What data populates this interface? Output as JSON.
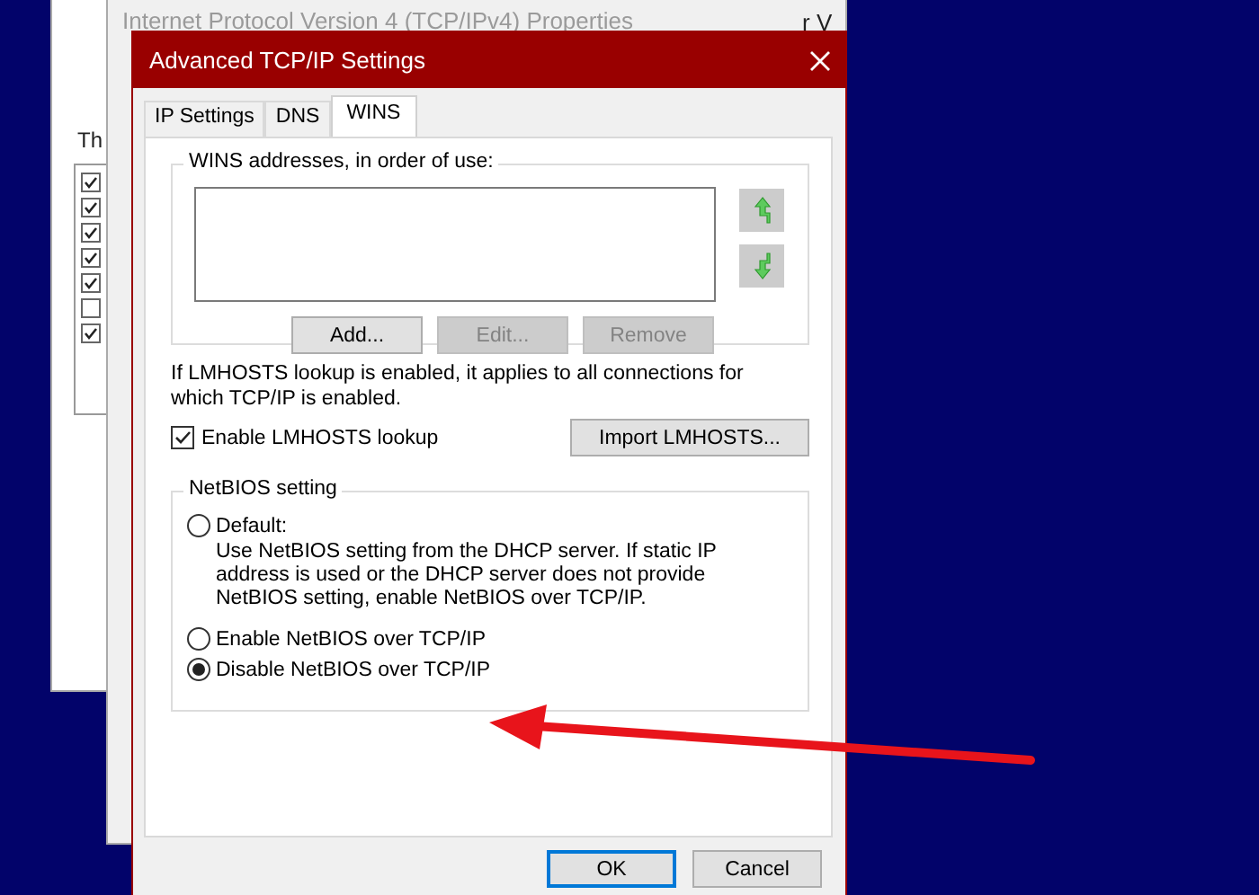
{
  "background_windows": [
    {
      "fragments": [
        "Th"
      ],
      "items": [
        {
          "checked": true
        },
        {
          "checked": true
        },
        {
          "checked": true
        },
        {
          "checked": true
        },
        {
          "checked": true
        },
        {
          "checked": false
        },
        {
          "checked": true
        }
      ]
    },
    {
      "title": "Internet Protocol Version 4 (TCP/IPv4) Properties",
      "fragments": [
        "r V"
      ]
    }
  ],
  "dialog": {
    "title": "Advanced TCP/IP Settings",
    "tabs": [
      {
        "label": "IP Settings",
        "selected": false
      },
      {
        "label": "DNS",
        "selected": false
      },
      {
        "label": "WINS",
        "selected": true
      }
    ],
    "wins_group": {
      "label": "WINS addresses, in order of use:",
      "buttons": [
        {
          "label": "Add...",
          "disabled": false
        },
        {
          "label": "Edit...",
          "disabled": true
        },
        {
          "label": "Remove",
          "disabled": true
        }
      ]
    },
    "lmhosts_note": "If LMHOSTS lookup is enabled, it applies to all connections for which TCP/IP is enabled.",
    "lmhosts_checkbox": {
      "label": "Enable LMHOSTS lookup",
      "checked": true
    },
    "import_button": "Import LMHOSTS...",
    "netbios_group": {
      "label": "NetBIOS setting",
      "options": [
        {
          "label": "Default:",
          "selected": false,
          "description": "Use NetBIOS setting from the DHCP server. If static IP address is used or the DHCP server does not provide NetBIOS setting, enable NetBIOS over TCP/IP."
        },
        {
          "label": "Enable NetBIOS over TCP/IP",
          "selected": false
        },
        {
          "label": "Disable NetBIOS over TCP/IP",
          "selected": true
        }
      ]
    },
    "buttons": [
      {
        "label": "OK",
        "default": true
      },
      {
        "label": "Cancel",
        "default": false
      }
    ]
  }
}
